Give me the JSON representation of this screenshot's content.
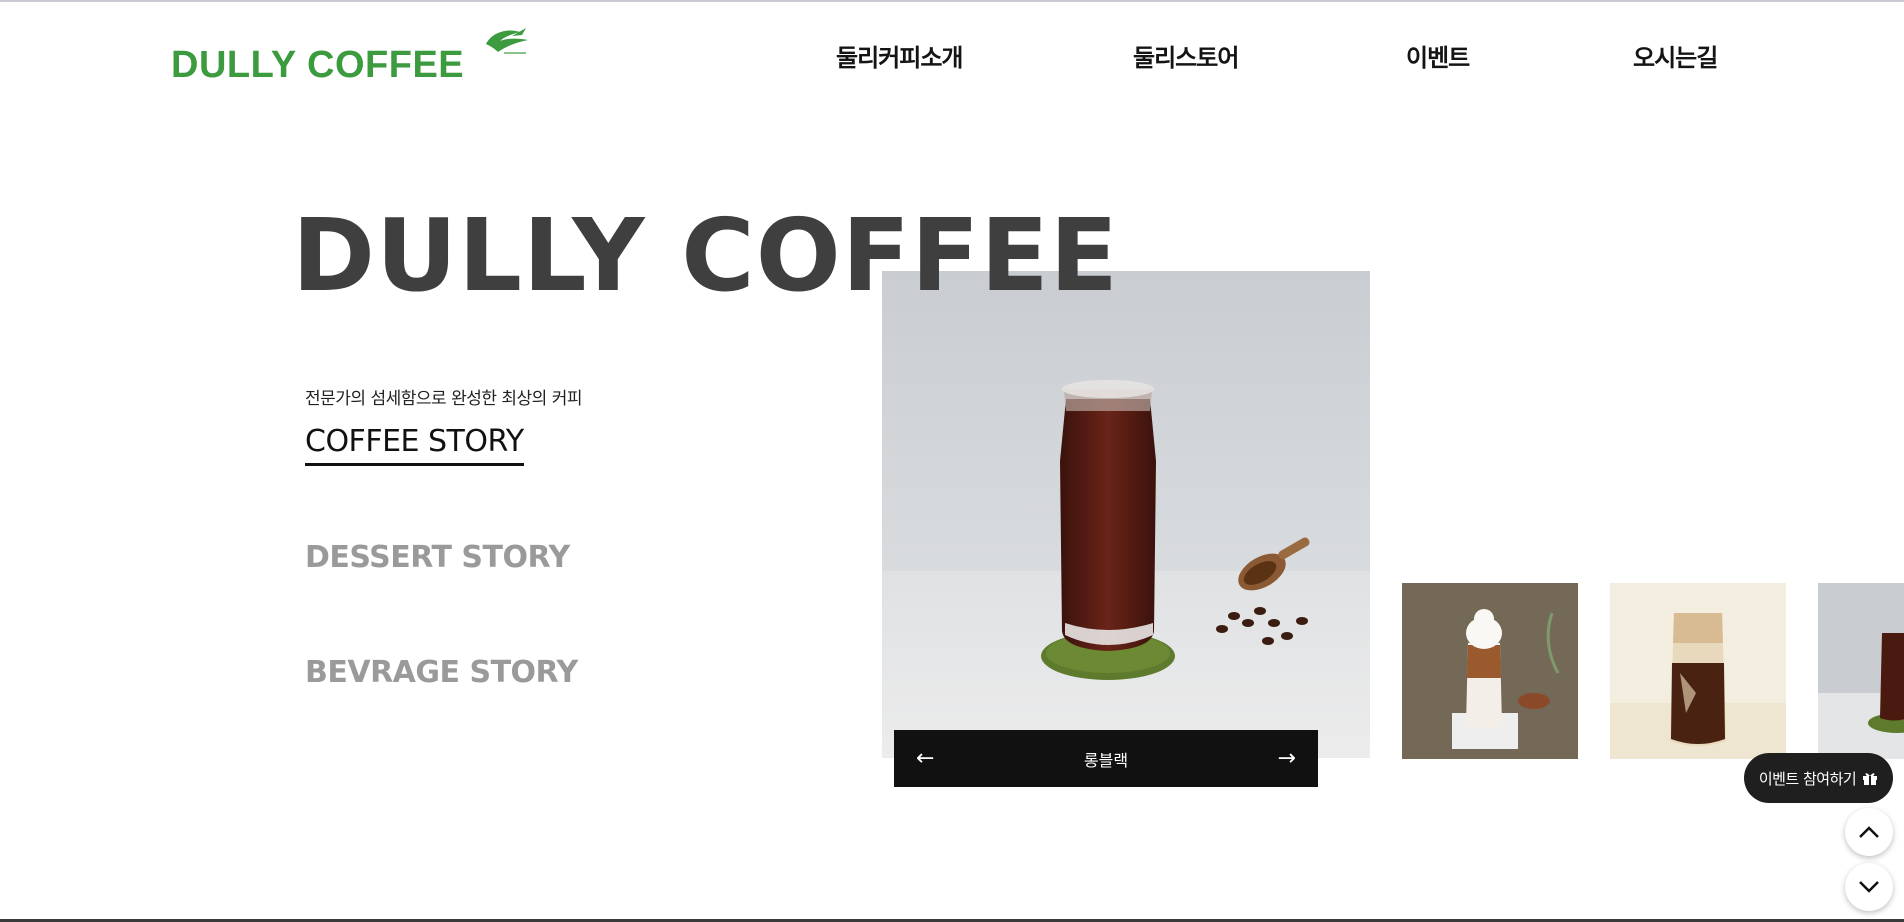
{
  "header": {
    "logo_text": "DULLY COFFEE",
    "nav": [
      {
        "label": "둘리커피소개"
      },
      {
        "label": "둘리스토어"
      },
      {
        "label": "이벤트"
      },
      {
        "label": "오시는길"
      }
    ]
  },
  "hero": {
    "title": "DULLY COFFEE",
    "tagline": "전문가의 섬세함으로 완성한 최상의 커피",
    "stories": [
      {
        "label": "COFFEE STORY",
        "active": true
      },
      {
        "label": "DESSERT STORY",
        "active": false
      },
      {
        "label": "BEVRAGE STORY",
        "active": false
      }
    ]
  },
  "slider": {
    "caption": "롱블랙",
    "prev_icon": "arrow-left-icon",
    "next_icon": "arrow-right-icon"
  },
  "floating": {
    "event_label": "이벤트 참여하기",
    "event_icon": "gift-icon",
    "up_icon": "chevron-up-icon",
    "down_icon": "chevron-down-icon"
  },
  "colors": {
    "brand_green": "#3c9a3f",
    "dark": "#111111",
    "inactive_gray": "#9a9a9a"
  }
}
